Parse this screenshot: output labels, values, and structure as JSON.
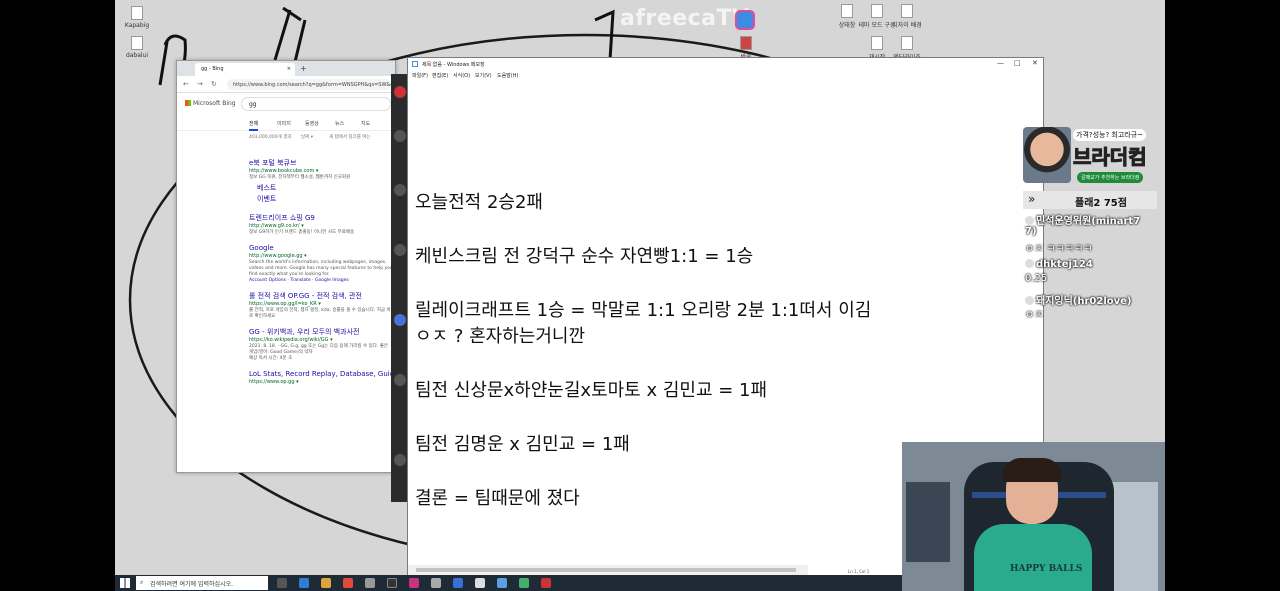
{
  "overlay": {
    "logo": "afreecaTV"
  },
  "desktop": {
    "left_icons": [
      "Kapabig",
      "dabalui"
    ],
    "top_right_icons": [
      "상태창",
      "테마 모드 구성",
      "디자이 배경"
    ],
    "top_right_icons_row2": [
      "재시작",
      "엔터라이즈"
    ],
    "center_icon_label": "방송"
  },
  "browser": {
    "tab_title": "gg - Bing",
    "tab_close": "×",
    "new_tab": "+",
    "nav_back": "←",
    "nav_forward": "→",
    "nav_refresh": "↻",
    "address": "https://www.bing.com/search?q=gg&form=WNSGPH&qs=SW&cvid=...",
    "bing_brand": "Microsoft Bing",
    "search_value": "gg",
    "tabs": [
      "전체",
      "이미지",
      "동영상",
      "뉴스",
      "지도"
    ],
    "filters": [
      "403,000,000개 결과",
      "날짜 ▾",
      "새 탭에서 링크를 여는"
    ],
    "results": [
      {
        "title": "e북 포털 북큐브",
        "url": "http://www.bookcube.com ▾",
        "desc": "정보 GG 북큐, 전자책부터 웹소설, 웹툰까지 신규회원",
        "sublinks": [
          "베스트",
          "이벤트"
        ]
      },
      {
        "title": "트렌드리이프 쇼핑 G9",
        "url": "http://www.g9.co.kr/ ▾",
        "desc": "정보 G9하가 인기 브랜드 총출동! 이니언 사도 무료배송"
      },
      {
        "title": "Google",
        "url": "http://www.google.gg ▾",
        "desc": "Search the world's information, including webpages, images, videos and more. Google has many special features to help you find exactly what you're looking for.",
        "links": "Account Options · Translate · Google Images"
      },
      {
        "title": "롤 전적 검색 OP.GG - 전적 검색, 관전",
        "url": "https://www.op.gg/l=ko_KR ▾",
        "desc": "롤 전적, 프로 게임의 전적, 챔프 랭킹, kda, 승률을 볼 수 있습니다. 지금 바로 확인하세요"
      },
      {
        "title": "GG - 위키백과, 우리 모두의 백과사전",
        "url": "https://ko.wikipedia.org/wiki/GG ▾",
        "desc": "2021. 8. 18. · GG, G.g, gg 또는 Gg는 다음 용례 가리킬 수 있다. 좋은 게임(영어: Good Game)의 약자",
        "extra": "예상 독서 시간: 4분 초"
      },
      {
        "title": "LoL Stats, Record Replay, Database, Guide",
        "url": "https://www.op.gg ▾"
      }
    ]
  },
  "notepad": {
    "title": "제목 없음 - Windows 메모장",
    "menu": [
      "파일(F)",
      "편집(E)",
      "서식(O)",
      "보기(V)",
      "도움말(H)"
    ],
    "controls": [
      "—",
      "□",
      "✕"
    ],
    "lines": [
      "오늘전적 2승2패",
      "케빈스크림 전 강덕구 순수 자연빵1:1 = 1승",
      "릴레이크래프트 1승 = 막말로 1:1 오리랑 2분 1:1떠서 이김",
      " ㅇㅈ ? 혼자하는거니깐",
      "팀전 신상문x하얀눈길x토마토 x 김민교 = 1패",
      "팀전 김명운 x 김민교 = 1패",
      "결론 = 팀때문에 졌다"
    ],
    "status": "Ln 1, Col 1"
  },
  "ad": {
    "slogan": "가격?성능? 최고라규~",
    "brand": "브라더컴",
    "sub": "갈매교가 추천하는 브라더컴"
  },
  "chat": {
    "score_label": "플래2 75점",
    "messages": [
      {
        "user": "민석운영위원(minart7",
        "cont": "7)",
        "text": "ㅇㅈ ㅋㅋㅋㅋㅋ"
      },
      {
        "user": "dhktej124",
        "text": "0.25"
      },
      {
        "user": "돼지잉닉(hr02love)",
        "text": "ㅇㅈ"
      }
    ]
  },
  "webcam": {
    "shirt_print": "HAPPY BALLS"
  },
  "taskbar": {
    "search_placeholder": "검색하려면 여기에 입력하십시오."
  },
  "colors": {
    "desktop": "#d6d6d6",
    "link": "#1a0dab",
    "url": "#006621",
    "chat_text": "#ffffff"
  }
}
